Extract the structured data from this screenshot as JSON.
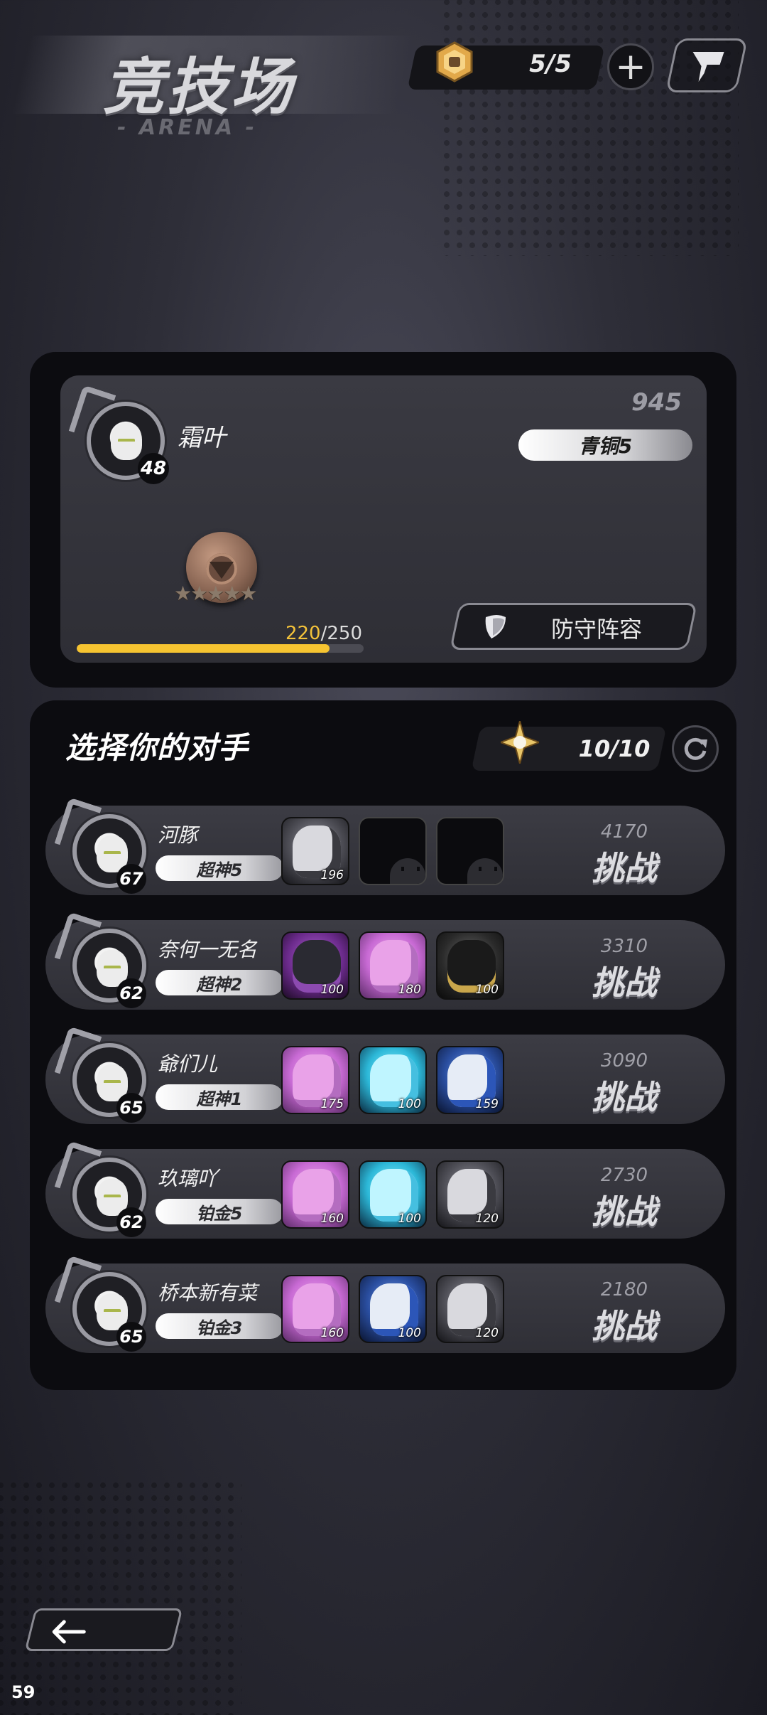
{
  "header": {
    "title": "竞技场",
    "subtitle": "- ARENA -",
    "tickets": "5/5"
  },
  "player": {
    "name": "霜叶",
    "level": "48",
    "score": "945",
    "rank": "青铜5",
    "xp_current": "220",
    "xp_max": "250",
    "xp_progress": 0.88,
    "defense_label": "防守阵容"
  },
  "opponents_section": {
    "title": "选择你的对手",
    "attempts": "10/10",
    "challenge_label": "挑战",
    "rows": [
      {
        "name": "河豚",
        "level": "67",
        "rank": "超神5",
        "power": "4170",
        "slots": [
          {
            "kind": "grey",
            "pw": "196"
          },
          {
            "kind": "empty",
            "pw": ""
          },
          {
            "kind": "empty",
            "pw": ""
          }
        ]
      },
      {
        "name": "奈何一无名",
        "level": "62",
        "rank": "超神2",
        "power": "3310",
        "slots": [
          {
            "kind": "darkpurple",
            "pw": "100"
          },
          {
            "kind": "purple",
            "pw": "180"
          },
          {
            "kind": "gold",
            "pw": "100"
          }
        ]
      },
      {
        "name": "爺们儿",
        "level": "65",
        "rank": "超神1",
        "power": "3090",
        "slots": [
          {
            "kind": "purple",
            "pw": "175"
          },
          {
            "kind": "cyan",
            "pw": "100"
          },
          {
            "kind": "blue",
            "pw": "159"
          }
        ]
      },
      {
        "name": "玖璃吖",
        "level": "62",
        "rank": "铂金5",
        "power": "2730",
        "slots": [
          {
            "kind": "purple",
            "pw": "160"
          },
          {
            "kind": "cyan",
            "pw": "100"
          },
          {
            "kind": "grey",
            "pw": "120"
          }
        ]
      },
      {
        "name": "桥本新有菜",
        "level": "65",
        "rank": "铂金3",
        "power": "2180",
        "slots": [
          {
            "kind": "purple",
            "pw": "160"
          },
          {
            "kind": "blue",
            "pw": "100"
          },
          {
            "kind": "grey",
            "pw": "120"
          }
        ]
      }
    ]
  },
  "footer": {
    "fps": "59"
  },
  "colors": {
    "xp_bar": "#f6c431",
    "background": "#2e2e38"
  },
  "icons": [
    "ticket-icon",
    "plus-icon",
    "flag-icon",
    "shield-icon",
    "star-token-icon",
    "refresh-icon",
    "back-arrow-icon"
  ]
}
